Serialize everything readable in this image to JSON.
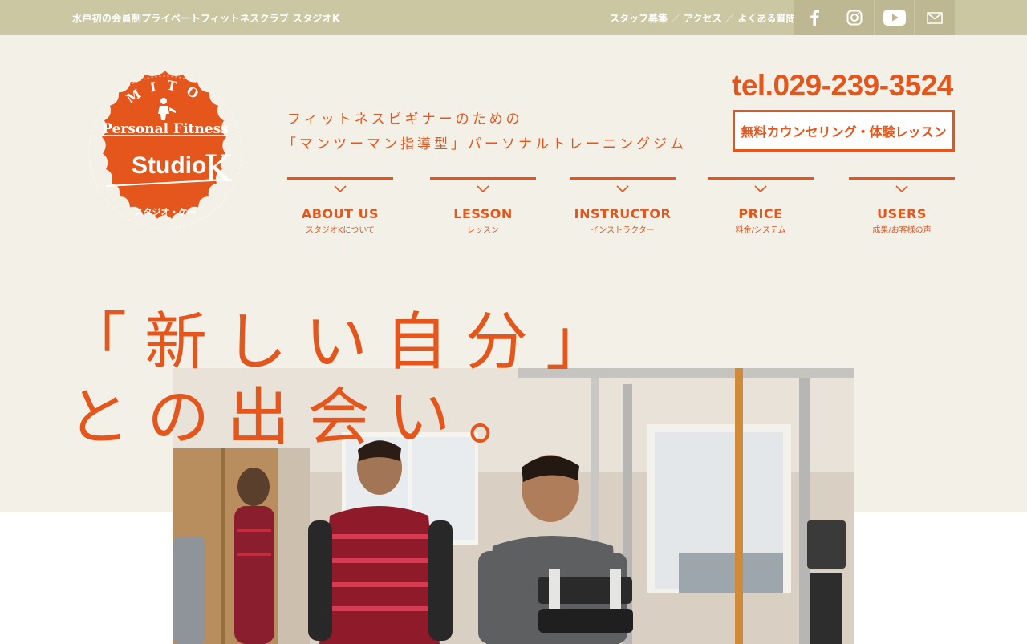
{
  "topbar": {
    "tagline": "水戸初の会員制プライベートフィットネスクラブ スタジオK",
    "links": [
      "スタッフ募集",
      "アクセス",
      "よくある質問"
    ],
    "separator": "／",
    "social_icons": [
      "facebook-icon",
      "instagram-icon",
      "youtube-icon",
      "mail-icon"
    ]
  },
  "logo": {
    "arc_text": "MITO",
    "line1": "Personal Fitness",
    "line2": "Studio",
    "line2_k": "K",
    "bottom": "スタジオ・ケー"
  },
  "header": {
    "tagline_line1": "フィットネスビギナーのための",
    "tagline_line2": "「マンツーマン指導型」パーソナルトレーニングジム",
    "tel": "tel.029-239-3524",
    "cta_label": "無料カウンセリング・体験レッスン"
  },
  "nav": [
    {
      "en": "ABOUT US",
      "jp": "スタジオKについて"
    },
    {
      "en": "LESSON",
      "jp": "レッスン"
    },
    {
      "en": "INSTRUCTOR",
      "jp": "インストラクター"
    },
    {
      "en": "PRICE",
      "jp": "料金/システム"
    },
    {
      "en": "USERS",
      "jp": "成果/お客様の声"
    }
  ],
  "hero": {
    "catch_line1": "「新しい自分」",
    "catch_line2": "との出会い。"
  },
  "colors": {
    "accent": "#e4561c",
    "topbar": "#cbc7a3",
    "background": "#f2f0e7"
  }
}
